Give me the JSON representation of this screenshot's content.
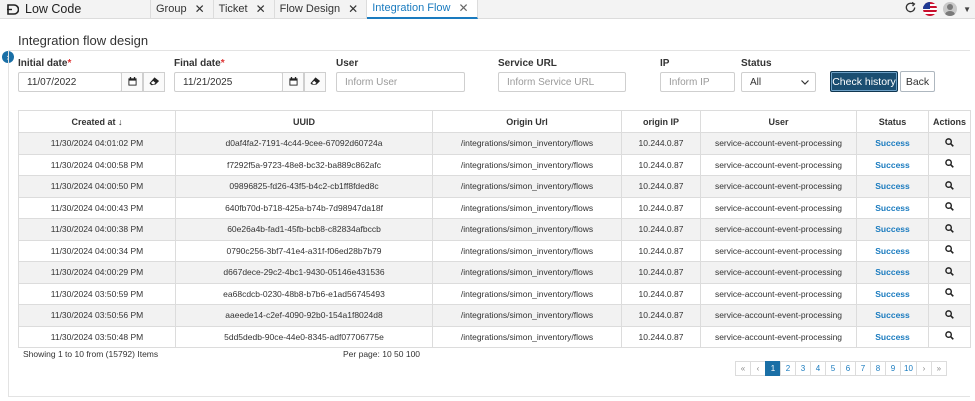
{
  "app": {
    "brand_label": "Low Code"
  },
  "tabs": [
    {
      "label": "Group",
      "active": false
    },
    {
      "label": "Ticket",
      "active": false
    },
    {
      "label": "Flow Design",
      "active": false
    },
    {
      "label": "Integration Flow",
      "active": true
    }
  ],
  "page": {
    "title": "Integration flow design"
  },
  "filters": {
    "initial_date": {
      "label": "Initial date",
      "required_mark": "*",
      "value": "11/07/2022"
    },
    "final_date": {
      "label": "Final date",
      "required_mark": "*",
      "value": "11/21/2025"
    },
    "user": {
      "label": "User",
      "placeholder": "Inform User"
    },
    "service_url": {
      "label": "Service URL",
      "placeholder": "Inform Service URL"
    },
    "ip": {
      "label": "IP",
      "placeholder": "Inform IP"
    },
    "status": {
      "label": "Status",
      "selected": "All"
    },
    "check_history_label": "Check history",
    "back_label": "Back"
  },
  "table": {
    "columns": [
      "Created at",
      "UUID",
      "Origin Url",
      "origin IP",
      "User",
      "Status",
      "Actions"
    ],
    "sort_arrow": "↓",
    "rows": [
      {
        "created_at": "11/30/2024 04:01:02 PM",
        "uuid": "d0af4fa2-7191-4c44-9cee-67092d60724a",
        "origin_url": "/integrations/simon_inventory/flows",
        "origin_ip": "10.244.0.87",
        "user": "service-account-event-processing",
        "status": "Success"
      },
      {
        "created_at": "11/30/2024 04:00:58 PM",
        "uuid": "f7292f5a-9723-48e8-bc32-ba889c862afc",
        "origin_url": "/integrations/simon_inventory/flows",
        "origin_ip": "10.244.0.87",
        "user": "service-account-event-processing",
        "status": "Success"
      },
      {
        "created_at": "11/30/2024 04:00:50 PM",
        "uuid": "09896825-fd26-43f5-b4c2-cb1ff8fded8c",
        "origin_url": "/integrations/simon_inventory/flows",
        "origin_ip": "10.244.0.87",
        "user": "service-account-event-processing",
        "status": "Success"
      },
      {
        "created_at": "11/30/2024 04:00:43 PM",
        "uuid": "640fb70d-b718-425a-b74b-7d98947da18f",
        "origin_url": "/integrations/simon_inventory/flows",
        "origin_ip": "10.244.0.87",
        "user": "service-account-event-processing",
        "status": "Success"
      },
      {
        "created_at": "11/30/2024 04:00:38 PM",
        "uuid": "60e26a4b-fad1-45fb-bcb8-c82834afbccb",
        "origin_url": "/integrations/simon_inventory/flows",
        "origin_ip": "10.244.0.87",
        "user": "service-account-event-processing",
        "status": "Success"
      },
      {
        "created_at": "11/30/2024 04:00:34 PM",
        "uuid": "0790c256-3bf7-41e4-a31f-f06ed28b7b79",
        "origin_url": "/integrations/simon_inventory/flows",
        "origin_ip": "10.244.0.87",
        "user": "service-account-event-processing",
        "status": "Success"
      },
      {
        "created_at": "11/30/2024 04:00:29 PM",
        "uuid": "d667dece-29c2-4bc1-9430-05146e431536",
        "origin_url": "/integrations/simon_inventory/flows",
        "origin_ip": "10.244.0.87",
        "user": "service-account-event-processing",
        "status": "Success"
      },
      {
        "created_at": "11/30/2024 03:50:59 PM",
        "uuid": "ea68cdcb-0230-48b8-b7b6-e1ad56745493",
        "origin_url": "/integrations/simon_inventory/flows",
        "origin_ip": "10.244.0.87",
        "user": "service-account-event-processing",
        "status": "Success"
      },
      {
        "created_at": "11/30/2024 03:50:56 PM",
        "uuid": "aaeede14-c2ef-4090-92b0-154a1f8024d8",
        "origin_url": "/integrations/simon_inventory/flows",
        "origin_ip": "10.244.0.87",
        "user": "service-account-event-processing",
        "status": "Success"
      },
      {
        "created_at": "11/30/2024 03:50:48 PM",
        "uuid": "5dd5dedb-90ce-44e0-8345-adf07706775e",
        "origin_url": "/integrations/simon_inventory/flows",
        "origin_ip": "10.244.0.87",
        "user": "service-account-event-processing",
        "status": "Success"
      }
    ]
  },
  "footer": {
    "showing_text": "Showing 1 to 10 from (15792) Items",
    "per_page_text": "Per page: 10 50 100"
  },
  "pagination": {
    "first": "«",
    "prev": "‹",
    "pages": [
      "1",
      "2",
      "3",
      "4",
      "5",
      "6",
      "7",
      "8",
      "9",
      "10"
    ],
    "active_page": "1",
    "next": "›",
    "last": "»"
  },
  "colors": {
    "accent": "#1a7bbf",
    "primary_button": "#1b4e71",
    "status_success": "#1a7bbf"
  },
  "icons": {
    "brand": "low-code-logo-icon",
    "refresh": "refresh-icon",
    "flag": "us-flag-icon",
    "avatar": "user-avatar-icon",
    "calendar": "calendar-icon",
    "eraser": "eraser-icon",
    "search": "search-icon",
    "sidebar": "chevron-right-icon"
  }
}
